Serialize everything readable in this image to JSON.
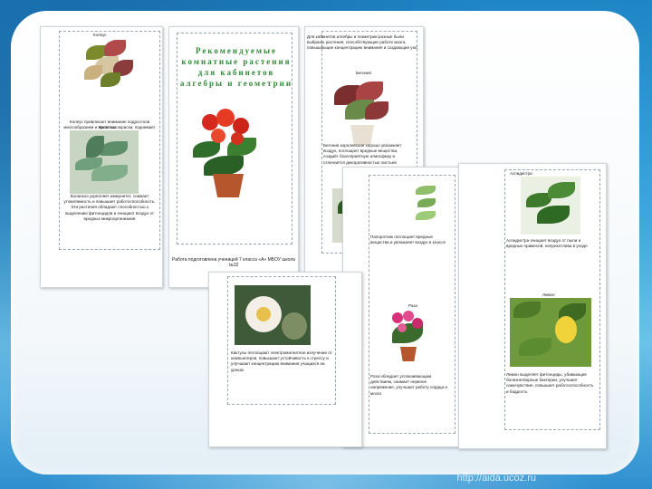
{
  "watermark": "http://aida.ucoz.ru",
  "pages": {
    "p1": {
      "coleus_caption": "Колеус",
      "coleus_text": "Колеус привлекает внимание подростков многообразием и яркостью окраски, поднимает настроение",
      "kalanchoe_caption": "Каланхоэ",
      "kalanchoe_text": "Каланхоэ укрепляет иммунитет, снижает утомляемость и повышает работоспособность. Эти растения обладают способностью к выделению фитонцидов и очищают воздух от вредных микроорганизмов"
    },
    "p2": {
      "title": "Рекомендуемые комнатные растения для кабинетов алгебры и геометрии",
      "footer": "Работа подготовлена ученицей 7 класса «А» МБОУ школа №32",
      "author": "Страшенко Анастасия"
    },
    "p3": {
      "intro": "Для кабинетов алгебры и геометрии разные были выбраны растения, способствующие работе мозга, повышающие концентрацию внимания и создающие уют.",
      "begonia_caption": "Бегония",
      "begonia_text": "Бегония королевская хорошо увлажняет воздух, поглощает вредные вещества, создаёт благоприятную атмосферу и отличается декоративностью листьев",
      "ficus_caption": "Фикус",
      "ficus_text": "Фикус очищает воздух от формальдегида, бензола, успокаивает нервную систему и способствует сосредоточенности"
    },
    "p4": {
      "cactus_text": "Кактусы поглощают электромагнитное излучение от компьютеров, повышают устойчивость к стрессу и улучшают концентрацию внимания учащихся на уроках"
    },
    "p5": {
      "fern_text": "Папоротник поглощает вредные вещества и увлажняет воздух в классе",
      "rose_caption": "Роза",
      "rose_text": "Роза обладает успокаивающим действием, снимает нервное напряжение, улучшает работу сердца и мозга"
    },
    "p6": {
      "aspidistra_caption": "Аспидистра",
      "aspidistra_text": "Аспидистра очищает воздух от пыли и вредных примесей, неприхотлива в уходе",
      "lemon_caption": "Лимон",
      "lemon_text": "Лимон выделяет фитонциды, убивающие болезнетворные бактерии, улучшает самочувствие, повышает работоспособность и бодрость"
    }
  }
}
